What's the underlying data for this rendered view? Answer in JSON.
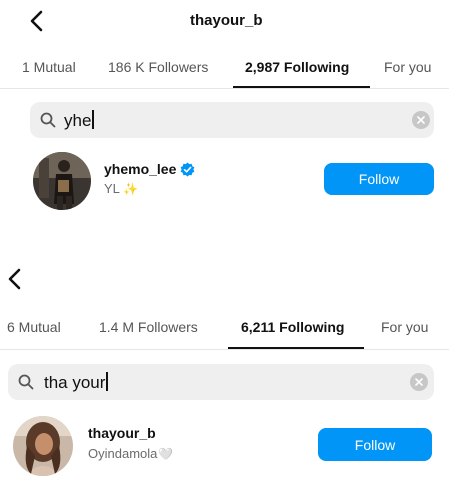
{
  "screens": [
    {
      "title": "thayour_b",
      "tabs": [
        "1 Mutual",
        "186 K Followers",
        "2,987 Following",
        "For you"
      ],
      "active_tab": "2,987 Following",
      "search": {
        "query": "yhe"
      },
      "result": {
        "username": "yhemo_lee",
        "full_name": "YL",
        "full_name_emoji": "✨",
        "verified": true
      },
      "follow_label": "Follow"
    },
    {
      "title": "",
      "tabs": [
        "6 Mutual",
        "1.4 M Followers",
        "6,211 Following",
        "For you"
      ],
      "active_tab": "6,211 Following",
      "search": {
        "query": "tha your"
      },
      "result": {
        "username": "thayour_b",
        "full_name": "Oyindamola",
        "full_name_emoji": "🤍",
        "verified": false
      },
      "follow_label": "Follow"
    }
  ],
  "colors": {
    "follow_button": "#0095f6",
    "verified_badge": "#0095f6",
    "search_bg": "#efefef"
  },
  "icons": [
    "back-arrow-icon",
    "search-icon",
    "clear-icon",
    "verified-badge-icon",
    "sparkles-icon",
    "white-heart-icon"
  ]
}
